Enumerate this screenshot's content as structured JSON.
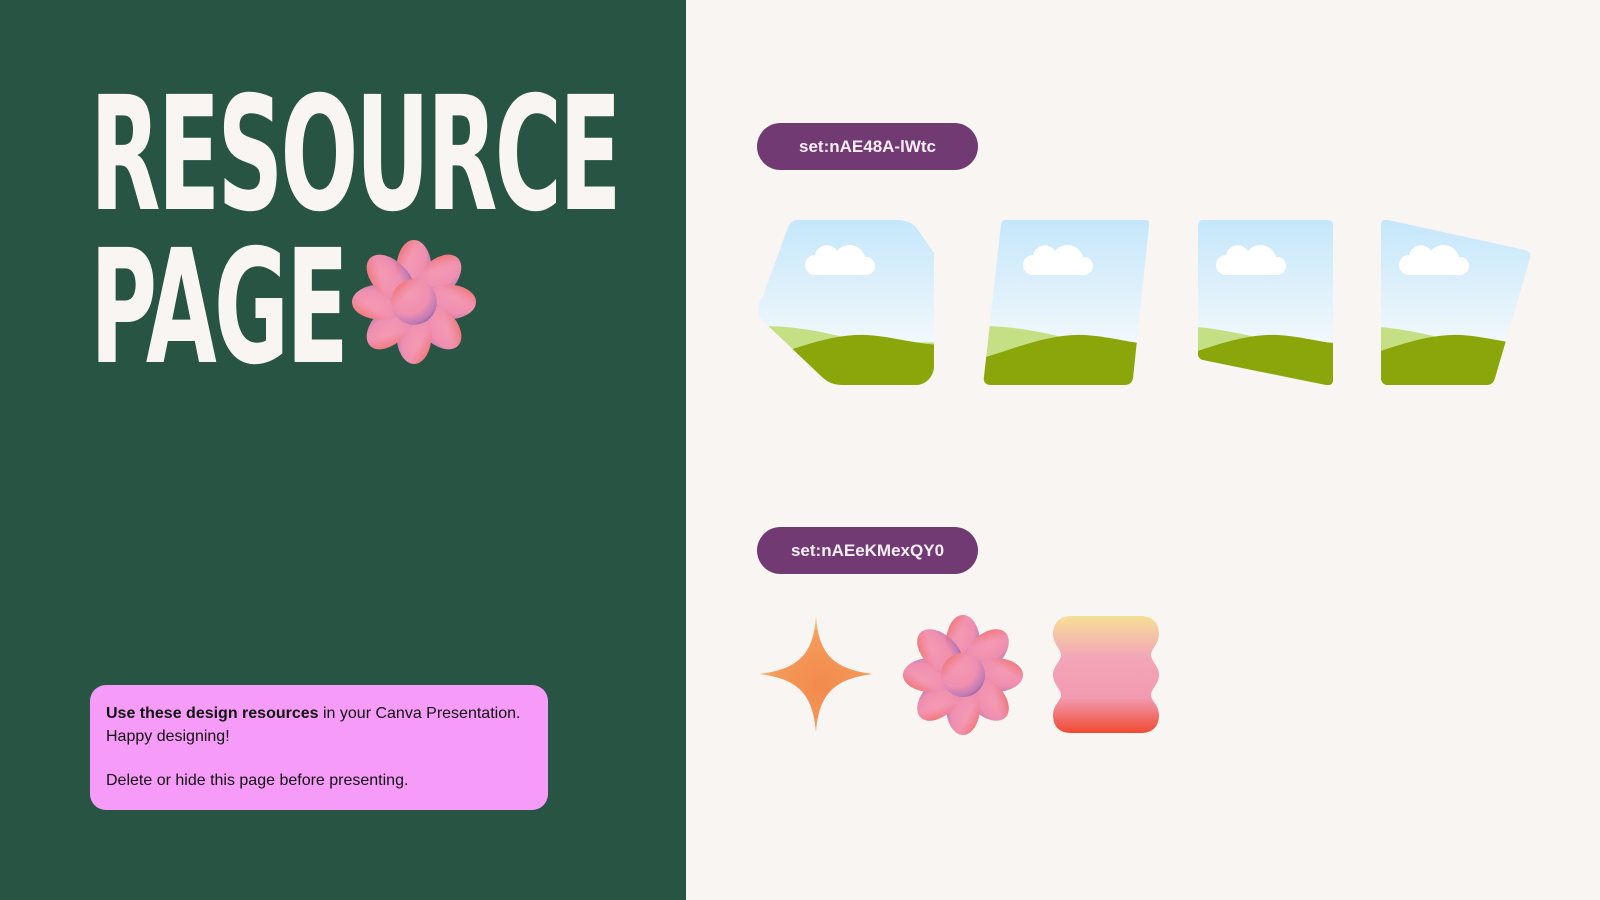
{
  "title": {
    "line1": "RESOURCE",
    "line2": "PAGE"
  },
  "note": {
    "bold_text": "Use these design resources",
    "rest_text": " in your Canva Presentation.",
    "line2": "Happy designing!",
    "line3": "Delete or hide this page before presenting."
  },
  "sets": [
    {
      "label": "set:nAE48A-lWtc"
    },
    {
      "label": "set:nAEeKMexQY0"
    }
  ],
  "colors": {
    "left_panel": "#275443",
    "background": "#f8f5f2",
    "note_box": "#f69cf8",
    "pill": "#713a73"
  },
  "icons": {
    "title_decoration": "flower-icon",
    "frames": [
      "hexagon-photo-frame-icon",
      "slanted-photo-frame-icon",
      "angled-bottom-photo-frame-icon",
      "skewed-photo-frame-icon"
    ],
    "shapes": [
      "four-point-star-icon",
      "flower-icon",
      "wavy-blob-icon"
    ]
  }
}
